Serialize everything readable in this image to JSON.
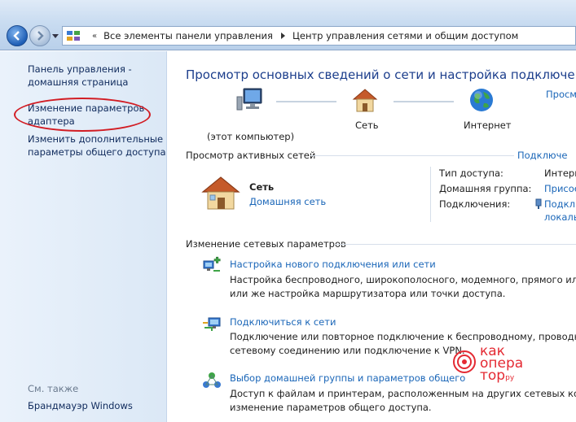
{
  "addressbar": {
    "crumb_1": "Все элементы панели управления",
    "crumb_2": "Центр управления сетями и общим доступом",
    "separator": "«"
  },
  "sidebar": {
    "home_line1": "Панель управления -",
    "home_line2": "домашняя страница",
    "adapter_line1": "Изменение параметров",
    "adapter_line2": "адаптера",
    "sharing_line1": "Изменить дополнительные",
    "sharing_line2": "параметры общего доступа",
    "see_also": "См. также",
    "firewall": "Брандмауэр Windows"
  },
  "main": {
    "title": "Просмотр основных сведений о сети и настройка подключений",
    "view_full_map": "Просм",
    "map": {
      "computer_label": "(этот компьютер)",
      "network_label": "Сеть",
      "internet_label": "Интернет"
    },
    "active_networks": {
      "heading": "Просмотр активных сетей",
      "connect_link": "Подключе",
      "network_name": "Сеть",
      "network_type": "Домашняя сеть",
      "access_type_label": "Тип доступа:",
      "access_type_value": "Интерн",
      "homegroup_label": "Домашняя группа:",
      "homegroup_value": "Присое",
      "connections_label": "Подключения:",
      "connections_value_1": "Подклю",
      "connections_value_2": "локаль"
    },
    "change_settings": {
      "heading": "Изменение сетевых параметров",
      "tasks": [
        {
          "title": "Настройка нового подключения или сети",
          "desc_line1": "Настройка беспроводного, широкополосного, модемного, прямого или VPN",
          "desc_line2": "или же настройка маршрутизатора или точки доступа."
        },
        {
          "title": "Подключиться к сети",
          "desc_line1": "Подключение или повторное подключение к беспроводному, проводному,",
          "desc_line2": "сетевому соединению или подключение к VPN."
        },
        {
          "title": "Выбор домашней группы и параметров общего",
          "desc_line1": "Доступ к файлам и принтерам, расположенным на других сетевых компьют",
          "desc_line2": "изменение параметров общего доступа."
        }
      ]
    }
  },
  "watermark": {
    "line1": "как",
    "line2": "опера",
    "line3": "тор",
    "suffix": "ру"
  },
  "colors": {
    "link": "#1a66b8",
    "title": "#1c3e8c",
    "highlight": "#d21d24",
    "watermark": "#e42a33"
  }
}
